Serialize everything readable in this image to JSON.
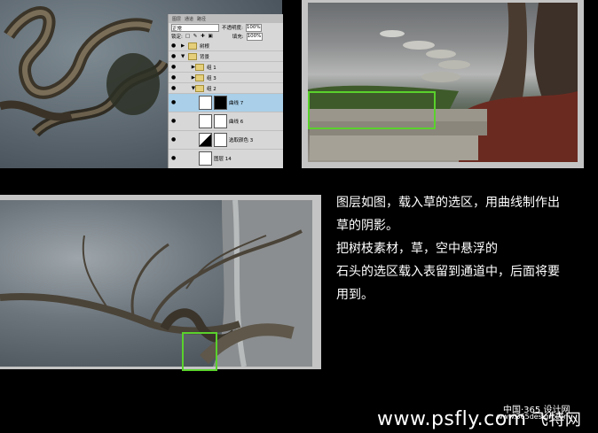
{
  "layers_panel": {
    "tabs": [
      "图层",
      "通道",
      "路径"
    ],
    "blend_mode": "正常",
    "opacity_label": "不透明度:",
    "opacity_value": "100%",
    "lock_label": "锁定:",
    "fill_label": "填充:",
    "fill_value": "100%",
    "layers": [
      {
        "name": "树根",
        "type": "group"
      },
      {
        "name": "背景",
        "type": "group"
      },
      {
        "name": "组 1",
        "type": "group"
      },
      {
        "name": "组 3",
        "type": "group"
      },
      {
        "name": "组 2",
        "type": "group"
      },
      {
        "name": "曲线 7",
        "type": "adjustment",
        "selected": true
      },
      {
        "name": "曲线 6",
        "type": "adjustment"
      },
      {
        "name": "选取颜色 3",
        "type": "adjustment"
      },
      {
        "name": "图层 14",
        "type": "layer"
      }
    ]
  },
  "description": {
    "line1": "图层如图，载入草的选区，用曲线制作出",
    "line2": "草的阴影。",
    "line3": "把树枝素材，草，空中悬浮的",
    "line4": "石头的选区载入表留到通道中，后面将要",
    "line5": "用到。"
  },
  "footer": {
    "site": "www.psfly.com",
    "site_suffix": "  飞特网",
    "watermark": "中国·365 设计网",
    "watermark_url": "www.365design.com"
  },
  "colors": {
    "highlight_box": "#5ad12c",
    "background": "#000000",
    "frame": "#c4c4c4"
  }
}
